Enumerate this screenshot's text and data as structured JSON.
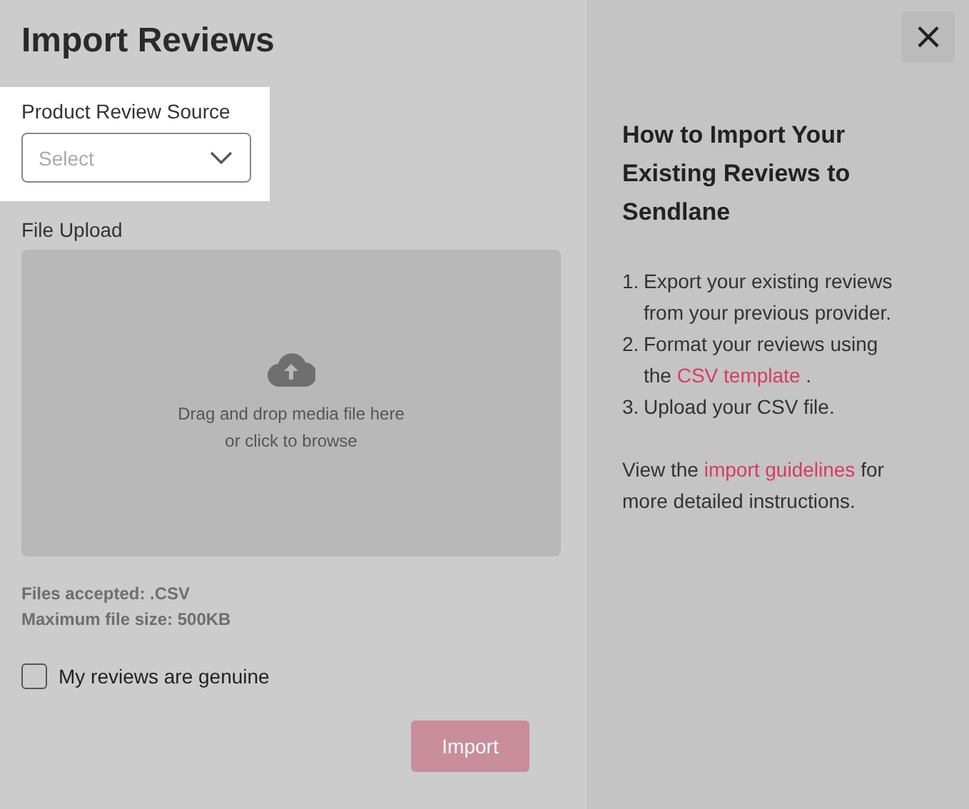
{
  "title": "Import Reviews",
  "source": {
    "label": "Product Review Source",
    "placeholder": "Select"
  },
  "upload": {
    "label": "File Upload",
    "hint_lines": [
      "Drag and drop media file here",
      "or click to browse"
    ]
  },
  "notes": [
    "Files accepted: .CSV",
    "Maximum file size: 500KB"
  ],
  "agreement": {
    "label": "My reviews are genuine",
    "checked": false
  },
  "import_button": {
    "label": "Import",
    "disabled": true
  },
  "close_button": "×",
  "help": {
    "title": "How to Import Your Existing Reviews to Sendlane",
    "steps": [
      {
        "number": "1.",
        "parts": [
          {
            "text": "Export your existing reviews from your previous provider.",
            "kind": "text"
          }
        ]
      },
      {
        "number": "2.",
        "parts": [
          {
            "text": "Format your reviews using the ",
            "kind": "text"
          },
          {
            "text": "CSV template",
            "kind": "link"
          },
          {
            "text": " .",
            "kind": "text"
          }
        ]
      },
      {
        "number": "3.",
        "parts": [
          {
            "text": "Upload your CSV file.",
            "kind": "text"
          }
        ]
      }
    ],
    "footer": [
      {
        "text": "View the ",
        "kind": "text"
      },
      {
        "text": "import guidelines",
        "kind": "link"
      },
      {
        "text": " for more detailed instructions.",
        "kind": "text"
      }
    ]
  }
}
